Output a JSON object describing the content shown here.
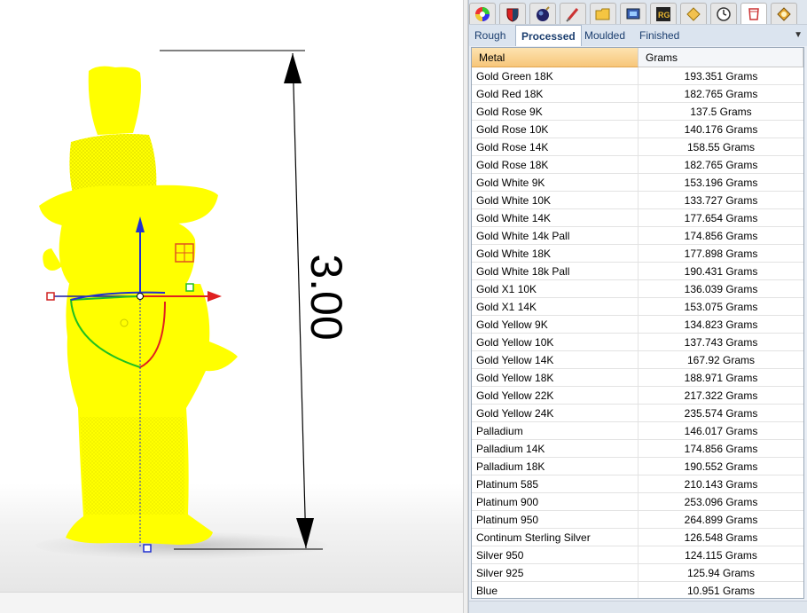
{
  "viewport": {
    "dimension_label": "3.00",
    "model_color": "#ffff00",
    "gumball_colors": {
      "x_axis": "#e02020",
      "y_axis": "#20c020",
      "z_axis": "#2030d0"
    }
  },
  "toolbar": {
    "tabs": [
      {
        "icon": "color-wheel-icon"
      },
      {
        "icon": "shield-icon"
      },
      {
        "icon": "globe-icon"
      },
      {
        "icon": "brush-icon"
      },
      {
        "icon": "folder-icon"
      },
      {
        "icon": "display-icon"
      },
      {
        "icon": "rg-logo-icon"
      },
      {
        "icon": "diamond-icon"
      },
      {
        "icon": "clock-icon"
      },
      {
        "icon": "cup-icon"
      },
      {
        "icon": "gem-icon"
      }
    ]
  },
  "tabs": [
    {
      "label": "Rough",
      "active": false
    },
    {
      "label": "Processed",
      "active": true
    },
    {
      "label": "Moulded",
      "active": false
    },
    {
      "label": "Finished",
      "active": false
    }
  ],
  "grid": {
    "columns": [
      "Metal",
      "Grams"
    ],
    "rows": [
      {
        "metal": "Gold Green 18K",
        "grams": "193.351 Grams"
      },
      {
        "metal": "Gold Red 18K",
        "grams": "182.765 Grams"
      },
      {
        "metal": "Gold Rose 9K",
        "grams": "137.5 Grams"
      },
      {
        "metal": "Gold Rose 10K",
        "grams": "140.176 Grams"
      },
      {
        "metal": "Gold Rose 14K",
        "grams": "158.55 Grams"
      },
      {
        "metal": "Gold Rose 18K",
        "grams": "182.765 Grams"
      },
      {
        "metal": "Gold White 9K",
        "grams": "153.196 Grams"
      },
      {
        "metal": "Gold White 10K",
        "grams": "133.727 Grams"
      },
      {
        "metal": "Gold White 14K",
        "grams": "177.654 Grams"
      },
      {
        "metal": "Gold White 14k Pall",
        "grams": "174.856 Grams"
      },
      {
        "metal": "Gold White 18K",
        "grams": "177.898 Grams"
      },
      {
        "metal": "Gold White 18k Pall",
        "grams": "190.431 Grams"
      },
      {
        "metal": "Gold X1 10K",
        "grams": "136.039 Grams"
      },
      {
        "metal": "Gold X1 14K",
        "grams": "153.075 Grams"
      },
      {
        "metal": "Gold Yellow 9K",
        "grams": "134.823 Grams"
      },
      {
        "metal": "Gold Yellow 10K",
        "grams": "137.743 Grams"
      },
      {
        "metal": "Gold Yellow 14K",
        "grams": "167.92 Grams"
      },
      {
        "metal": "Gold Yellow 18K",
        "grams": "188.971 Grams"
      },
      {
        "metal": "Gold Yellow 22K",
        "grams": "217.322 Grams"
      },
      {
        "metal": "Gold Yellow 24K",
        "grams": "235.574 Grams"
      },
      {
        "metal": "Palladium",
        "grams": "146.017 Grams"
      },
      {
        "metal": "Palladium 14K",
        "grams": "174.856 Grams"
      },
      {
        "metal": "Palladium 18K",
        "grams": "190.552 Grams"
      },
      {
        "metal": "Platinum 585",
        "grams": "210.143 Grams"
      },
      {
        "metal": "Platinum 900",
        "grams": "253.096 Grams"
      },
      {
        "metal": "Platinum 950",
        "grams": "264.899 Grams"
      },
      {
        "metal": "Continum Sterling Silver",
        "grams": "126.548 Grams"
      },
      {
        "metal": "Silver 950",
        "grams": "124.115 Grams"
      },
      {
        "metal": "Silver 925",
        "grams": "125.94 Grams"
      },
      {
        "metal": "Blue",
        "grams": "10.951 Grams"
      }
    ]
  }
}
